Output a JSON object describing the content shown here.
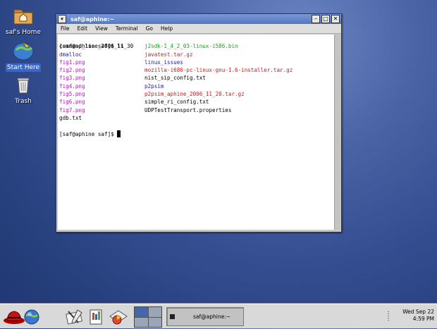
{
  "desktop": {
    "icons": [
      {
        "label": "saf's Home",
        "selected": false
      },
      {
        "label": "Start Here",
        "selected": true
      },
      {
        "label": "Trash",
        "selected": false
      }
    ]
  },
  "window": {
    "title": "saf@aphine:~",
    "controls": {
      "menu": "▾",
      "minimize": "–",
      "maximize": "□",
      "close": "✕"
    },
    "menu": [
      "File",
      "Edit",
      "View",
      "Terminal",
      "Go",
      "Help"
    ]
  },
  "terminal": {
    "command_line": "[saf@aphine saf]$ ls",
    "rows": [
      {
        "left": "command_line_2006_11_30",
        "left_color": "#000000",
        "right": "j2sdk-1_4_2_03-linux-i586.bin",
        "right_color": "#17a317"
      },
      {
        "left": "dmalloc",
        "left_color": "#1c1cb8",
        "right": "javatest.tar.gz",
        "right_color": "#cc1a1a"
      },
      {
        "left": "fig1.png",
        "left_color": "#b319b3",
        "right": "linux_issues",
        "right_color": "#1c1cb8"
      },
      {
        "left": "fig2.png",
        "left_color": "#b319b3",
        "right": "mozilla-i686-pc-linux-gnu-1.6-installer.tar.gz",
        "right_color": "#cc1a1a"
      },
      {
        "left": "fig3.png",
        "left_color": "#b319b3",
        "right": "nist_sip_config.txt",
        "right_color": "#000000"
      },
      {
        "left": "fig4.png",
        "left_color": "#b319b3",
        "right": "p2psim",
        "right_color": "#1c1cb8"
      },
      {
        "left": "fig5.png",
        "left_color": "#b319b3",
        "right": "p2psim_aphine_2006_11_20.tar.gz",
        "right_color": "#cc1a1a"
      },
      {
        "left": "fig6.png",
        "left_color": "#b319b3",
        "right": "simple_ri_config.txt",
        "right_color": "#000000"
      },
      {
        "left": "fig7.png",
        "left_color": "#b319b3",
        "right": "UDPTestTransport.properties",
        "right_color": "#000000"
      },
      {
        "left": "gdb.txt",
        "left_color": "#000000",
        "right": "",
        "right_color": "#000000"
      }
    ],
    "prompt": "[saf@aphine saf]$ "
  },
  "panel": {
    "launchers": [
      "main-menu-icon",
      "web-browser-icon",
      "email-icon",
      "office-writer-icon",
      "presentation-icon",
      "spreadsheet-icon"
    ],
    "workspace_pager": {
      "workspaces": 4,
      "current": 1
    },
    "task": {
      "label": "saf@aphine:~"
    },
    "clock": {
      "date": "Wed Sep 22",
      "time": "4:59 PM"
    }
  }
}
